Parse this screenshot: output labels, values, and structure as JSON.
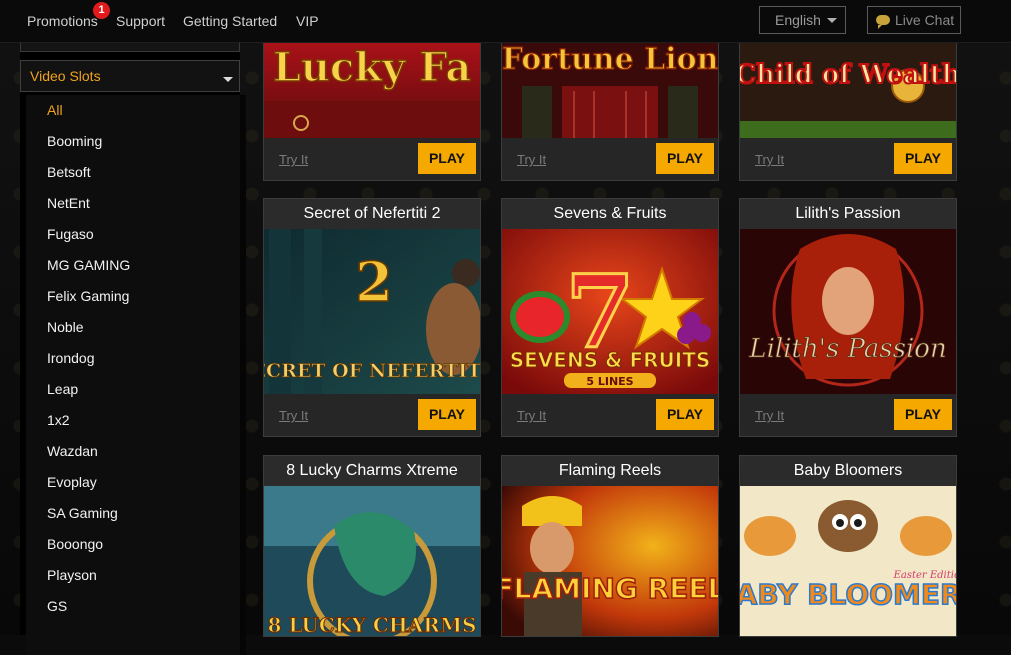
{
  "nav": {
    "items": [
      "Promotions",
      "Support",
      "Getting Started",
      "VIP"
    ],
    "promotions_badge": "1",
    "language": "English",
    "live_chat": "Live Chat"
  },
  "sidebar": {
    "category": "Video Slots",
    "providers": [
      "All",
      "Booming",
      "Betsoft",
      "NetEnt",
      "Fugaso",
      "MG GAMING",
      "Felix Gaming",
      "Noble",
      "Irondog",
      "Leap",
      "1x2",
      "Wazdan",
      "Evoplay",
      "SA Gaming",
      "Booongo",
      "Playson",
      "GS"
    ],
    "active_provider": "All"
  },
  "games": {
    "try_label": "Try It",
    "play_label": "PLAY",
    "row1": [
      {
        "art": "Lucky Fa"
      },
      {
        "art": "Fortune Lion"
      },
      {
        "art": "Child of Wealth"
      }
    ],
    "row2": [
      {
        "title": "Secret of Nefertiti 2",
        "art": "SECRET OF NEFERTITI",
        "art_num": "2"
      },
      {
        "title": "Sevens & Fruits",
        "art": "SEVENS & FRUITS",
        "art_sub": "5 LINES"
      },
      {
        "title": "Lilith's Passion",
        "art": "Lilith's Passion"
      }
    ],
    "row3": [
      {
        "title": "8 Lucky Charms Xtreme",
        "art": "8 LUCKY CHARMS"
      },
      {
        "title": "Flaming Reels",
        "art": "FLAMING REELS"
      },
      {
        "title": "Baby Bloomers",
        "art": "BABY BLOOMERS",
        "art_sub": "Easter Edition"
      }
    ]
  },
  "colors": {
    "accent": "#f5a800",
    "active": "#f0a31b",
    "badge": "#e11b1b"
  }
}
